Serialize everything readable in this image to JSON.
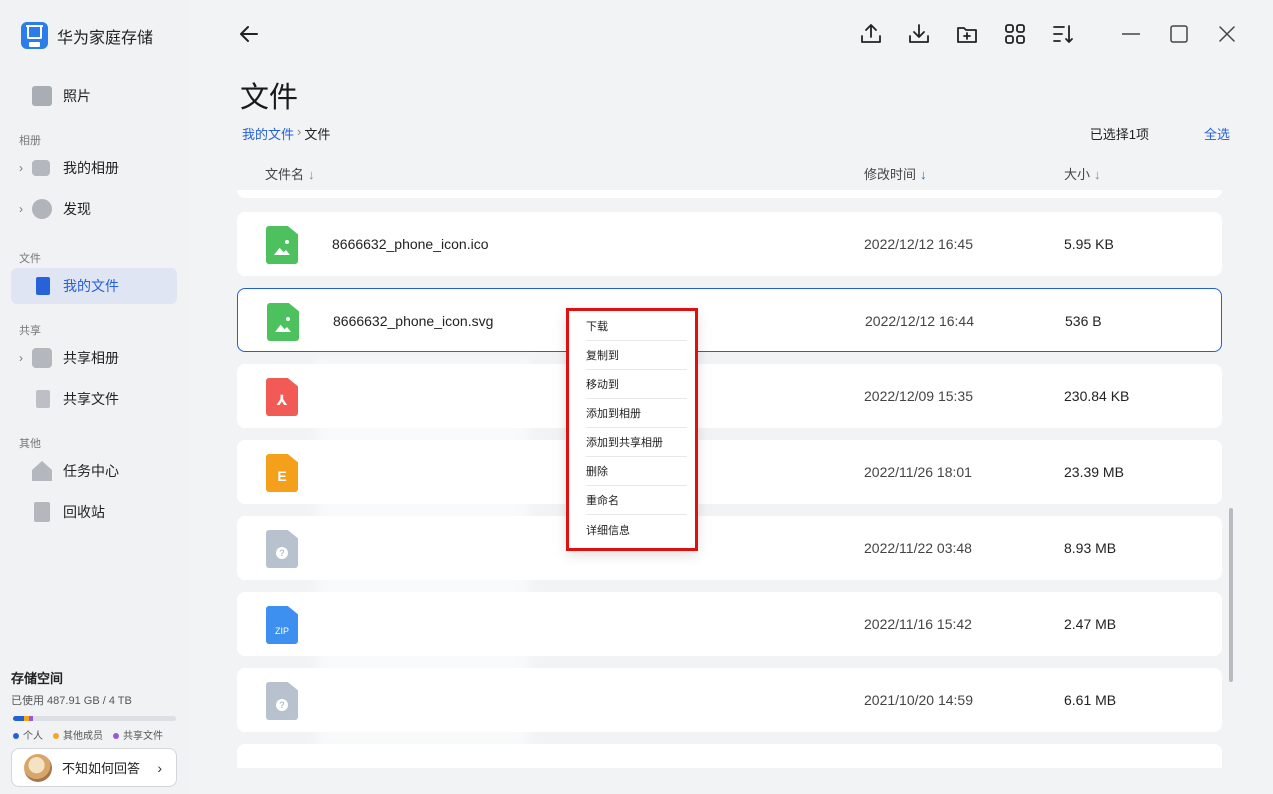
{
  "app": {
    "title": "华为家庭存储",
    "logo_icon": "house-icon"
  },
  "sidebar": {
    "photos": "照片",
    "section_album": "相册",
    "my_albums": "我的相册",
    "discover": "发现",
    "section_files": "文件",
    "my_files": "我的文件",
    "section_share": "共享",
    "shared_albums": "共享相册",
    "shared_files": "共享文件",
    "section_other": "其他",
    "task_center": "任务中心",
    "recycle_bin": "回收站"
  },
  "storage": {
    "title": "存储空间",
    "used": "已使用 487.91 GB / 4 TB",
    "legend": [
      {
        "label": "个人",
        "color": "#2660d6"
      },
      {
        "label": "其他成员",
        "color": "#f5a623"
      },
      {
        "label": "共享文件",
        "color": "#9b59d0"
      }
    ],
    "fraction_personal": 0.07,
    "fraction_members": 0.03,
    "fraction_shared": 0.02
  },
  "user": {
    "name": "不知如何回答"
  },
  "toolbar": {
    "back_icon": "back-arrow-icon",
    "icons": [
      "upload-icon",
      "download-icon",
      "new-folder-icon",
      "grid-view-icon",
      "sort-icon",
      "minimize-icon",
      "maximize-icon",
      "close-icon"
    ]
  },
  "page": {
    "title": "文件",
    "breadcrumb_root": "我的文件",
    "breadcrumb_sep": "›",
    "breadcrumb_current": "文件",
    "selected_count": "已选择1项",
    "select_all": "全选"
  },
  "columns": {
    "name": "文件名",
    "modified": "修改时间",
    "size": "大小"
  },
  "files": [
    {
      "name": "8666632_phone_icon.ico",
      "time": "2022/12/12 16:45",
      "size": "5.95 KB",
      "type": "image",
      "color": "#4cc15d"
    },
    {
      "name": "8666632_phone_icon.svg",
      "time": "2022/12/12 16:44",
      "size": "536 B",
      "type": "image",
      "color": "#4cc15d"
    },
    {
      "name": "",
      "time": "2022/12/09 15:35",
      "size": "230.84 KB",
      "type": "pdf",
      "color": "#f25a55"
    },
    {
      "name": "",
      "time": "2022/11/26 18:01",
      "size": "23.39 MB",
      "type": "e",
      "color": "#f5a01a"
    },
    {
      "name": "",
      "time": "2022/11/22 03:48",
      "size": "8.93 MB",
      "type": "unknown",
      "color": "#b8c2ce"
    },
    {
      "name": "",
      "time": "2022/11/16 15:42",
      "size": "2.47 MB",
      "type": "zip",
      "color": "#3d8ff0"
    },
    {
      "name": "",
      "time": "2021/10/20 14:59",
      "size": "6.61 MB",
      "type": "unknown",
      "color": "#b8c2ce"
    }
  ],
  "context_menu": [
    "下载",
    "复制到",
    "移动到",
    "添加到相册",
    "添加到共享相册",
    "删除",
    "重命名",
    "详细信息"
  ]
}
